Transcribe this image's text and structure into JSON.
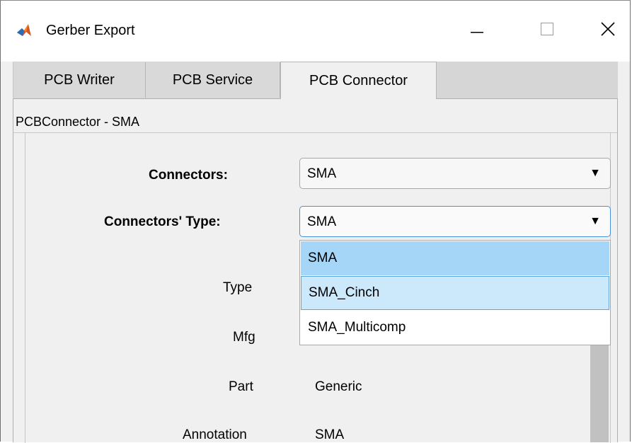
{
  "window": {
    "title": "Gerber Export",
    "app_icon": "matlab-logo-icon",
    "controls": {
      "minimize": "minimize-icon",
      "maximize": "maximize-icon",
      "close": "close-icon"
    }
  },
  "tabs": [
    {
      "label": "PCB Writer",
      "active": false
    },
    {
      "label": "PCB Service",
      "active": false
    },
    {
      "label": "PCB Connector",
      "active": true
    }
  ],
  "panel": {
    "header": "PCBConnector - SMA",
    "connectors": {
      "label": "Connectors:",
      "value": "SMA"
    },
    "connectors_type": {
      "label": "Connectors' Type:",
      "value": "SMA",
      "options": [
        "SMA",
        "SMA_Cinch",
        "SMA_Multicomp"
      ],
      "selected_index": 0,
      "hover_index": 1
    },
    "fields": [
      {
        "label": "Type",
        "value": ""
      },
      {
        "label": "Mfg",
        "value": ""
      },
      {
        "label": "Part",
        "value": "Generic"
      },
      {
        "label": "Annotation",
        "value": "SMA"
      }
    ]
  },
  "colors": {
    "selected_option": "#a6d6f7",
    "hover_option": "#cce8fb",
    "focus_border": "#4a90d9"
  }
}
